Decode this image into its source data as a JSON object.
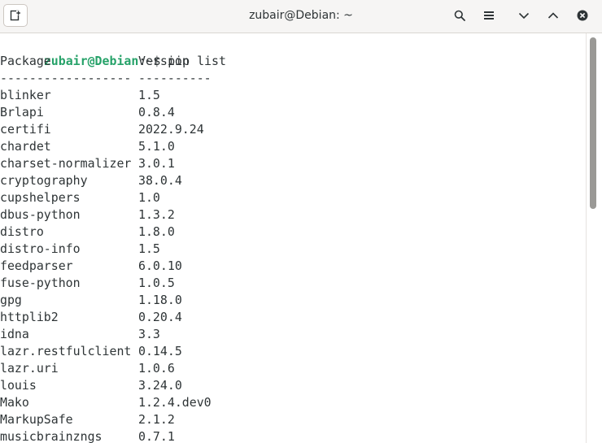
{
  "window": {
    "title": "zubair@Debian: ~"
  },
  "icons": {
    "new_tab": "new-tab-icon",
    "search": "search-icon",
    "menu": "hamburger-menu-icon",
    "minimize": "chevron-down-icon",
    "maximize": "chevron-up-icon",
    "close": "close-icon"
  },
  "terminal": {
    "prompt_user": "zubair@Debian",
    "prompt_path": ":~$",
    "command": " pip list",
    "header": {
      "package": "Package",
      "version": "Version"
    },
    "separator": {
      "package": "------------------",
      "version": "----------"
    },
    "rows": [
      {
        "package": "blinker",
        "version": "1.5"
      },
      {
        "package": "Brlapi",
        "version": "0.8.4"
      },
      {
        "package": "certifi",
        "version": "2022.9.24"
      },
      {
        "package": "chardet",
        "version": "5.1.0"
      },
      {
        "package": "charset-normalizer",
        "version": "3.0.1"
      },
      {
        "package": "cryptography",
        "version": "38.0.4"
      },
      {
        "package": "cupshelpers",
        "version": "1.0"
      },
      {
        "package": "dbus-python",
        "version": "1.3.2"
      },
      {
        "package": "distro",
        "version": "1.8.0"
      },
      {
        "package": "distro-info",
        "version": "1.5"
      },
      {
        "package": "feedparser",
        "version": "6.0.10"
      },
      {
        "package": "fuse-python",
        "version": "1.0.5"
      },
      {
        "package": "gpg",
        "version": "1.18.0"
      },
      {
        "package": "httplib2",
        "version": "0.20.4"
      },
      {
        "package": "idna",
        "version": "3.3"
      },
      {
        "package": "lazr.restfulclient",
        "version": "0.14.5"
      },
      {
        "package": "lazr.uri",
        "version": "1.0.6"
      },
      {
        "package": "louis",
        "version": "3.24.0"
      },
      {
        "package": "Mako",
        "version": "1.2.4.dev0"
      },
      {
        "package": "MarkupSafe",
        "version": "2.1.2"
      },
      {
        "package": "musicbrainzngs",
        "version": "0.7.1"
      }
    ]
  },
  "colors": {
    "prompt_user": "#26a269",
    "text": "#2e3436",
    "headerbar": "#f6f5f4",
    "scroll_thumb": "#9a9996"
  }
}
